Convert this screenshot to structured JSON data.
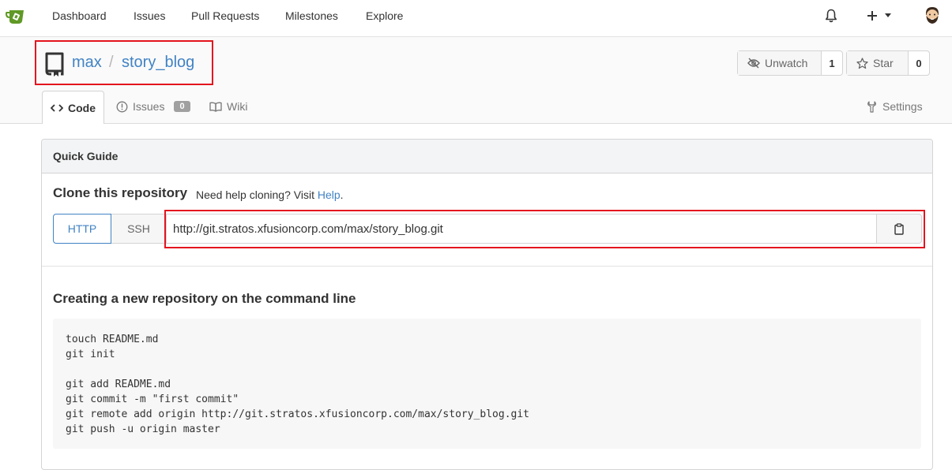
{
  "nav": {
    "items": [
      "Dashboard",
      "Issues",
      "Pull Requests",
      "Milestones",
      "Explore"
    ],
    "logo_icon": "gitea-logo-icon",
    "bell_icon": "bell-icon",
    "create_icon": "plus-icon",
    "create_caret_icon": "caret-down-icon",
    "avatar_icon": "user-avatar"
  },
  "repo": {
    "owner": "max",
    "separator": "/",
    "name": "story_blog",
    "icon": "repo-book-icon",
    "watch_label": "Unwatch",
    "watch_count": "1",
    "star_label": "Star",
    "star_count": "0"
  },
  "tabs": {
    "code": "Code",
    "issues": "Issues",
    "issues_count": "0",
    "wiki": "Wiki",
    "settings": "Settings"
  },
  "guide": {
    "title": "Quick Guide",
    "clone_title": "Clone this repository",
    "clone_help_prefix": "Need help cloning? Visit ",
    "clone_help_link": "Help",
    "clone_help_suffix": ".",
    "http_label": "HTTP",
    "ssh_label": "SSH",
    "clone_url": "http://git.stratos.xfusioncorp.com/max/story_blog.git",
    "copy_icon": "clipboard-icon",
    "cmd_title": "Creating a new repository on the command line",
    "cmd_lines": "touch README.md\ngit init\n\ngit add README.md\ngit commit -m \"first commit\"\ngit remote add origin http://git.stratos.xfusioncorp.com/max/story_blog.git\ngit push -u origin master"
  },
  "colors": {
    "accent": "#4183c4",
    "highlight": "#e4141e",
    "logo_green": "#609926"
  }
}
